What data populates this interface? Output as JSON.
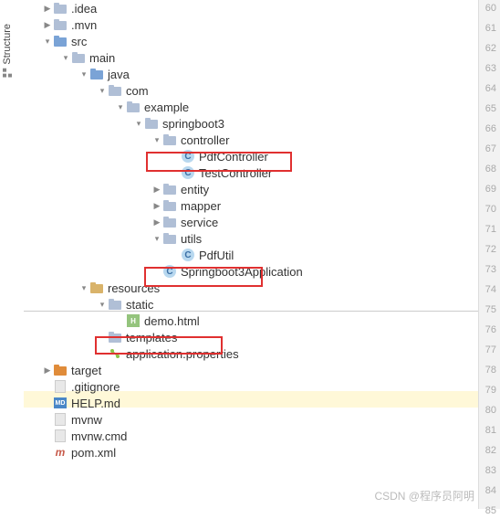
{
  "sidebar": {
    "tab": "Structure"
  },
  "tree": {
    "i0": ".idea",
    "i1": ".mvn",
    "i2": "src",
    "i3": "main",
    "i4": "java",
    "i5": "com",
    "i6": "example",
    "i7": "springboot3",
    "i8": "controller",
    "i9": "PdfController",
    "i10": "TestController",
    "i11": "entity",
    "i12": "mapper",
    "i13": "service",
    "i14": "utils",
    "i15": "PdfUtil",
    "i16": "Springboot3Application",
    "i17": "resources",
    "i18": "static",
    "i19": "demo.html",
    "i20": "templates",
    "i21": "application.properties",
    "i22": "target",
    "i23": ".gitignore",
    "i24": "HELP.md",
    "i25": "mvnw",
    "i26": "mvnw.cmd",
    "i27": "pom.xml"
  },
  "lines": {
    "l0": "60",
    "l1": "61",
    "l2": "62",
    "l3": "63",
    "l4": "64",
    "l5": "65",
    "l6": "66",
    "l7": "67",
    "l8": "68",
    "l9": "69",
    "l10": "70",
    "l11": "71",
    "l12": "72",
    "l13": "73",
    "l14": "74",
    "l15": "75",
    "l16": "76",
    "l17": "77",
    "l18": "78",
    "l19": "79",
    "l20": "80",
    "l21": "81",
    "l22": "82",
    "l23": "83",
    "l24": "84",
    "l25": "85"
  },
  "watermark": "CSDN @程序员阿明"
}
